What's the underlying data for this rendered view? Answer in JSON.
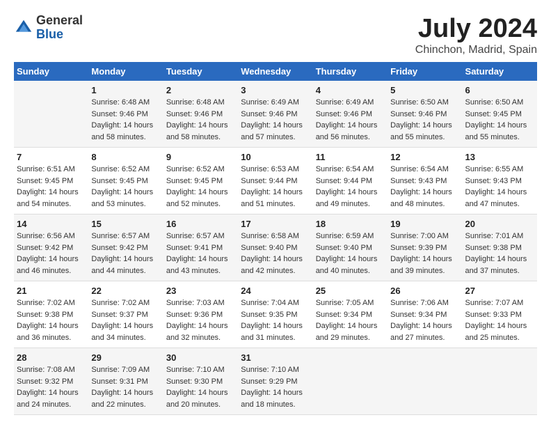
{
  "header": {
    "logo_general": "General",
    "logo_blue": "Blue",
    "main_title": "July 2024",
    "subtitle": "Chinchon, Madrid, Spain"
  },
  "days_of_week": [
    "Sunday",
    "Monday",
    "Tuesday",
    "Wednesday",
    "Thursday",
    "Friday",
    "Saturday"
  ],
  "weeks": [
    [
      {
        "day": "",
        "info": ""
      },
      {
        "day": "1",
        "info": "Sunrise: 6:48 AM\nSunset: 9:46 PM\nDaylight: 14 hours\nand 58 minutes."
      },
      {
        "day": "2",
        "info": "Sunrise: 6:48 AM\nSunset: 9:46 PM\nDaylight: 14 hours\nand 58 minutes."
      },
      {
        "day": "3",
        "info": "Sunrise: 6:49 AM\nSunset: 9:46 PM\nDaylight: 14 hours\nand 57 minutes."
      },
      {
        "day": "4",
        "info": "Sunrise: 6:49 AM\nSunset: 9:46 PM\nDaylight: 14 hours\nand 56 minutes."
      },
      {
        "day": "5",
        "info": "Sunrise: 6:50 AM\nSunset: 9:46 PM\nDaylight: 14 hours\nand 55 minutes."
      },
      {
        "day": "6",
        "info": "Sunrise: 6:50 AM\nSunset: 9:45 PM\nDaylight: 14 hours\nand 55 minutes."
      }
    ],
    [
      {
        "day": "7",
        "info": "Sunrise: 6:51 AM\nSunset: 9:45 PM\nDaylight: 14 hours\nand 54 minutes."
      },
      {
        "day": "8",
        "info": "Sunrise: 6:52 AM\nSunset: 9:45 PM\nDaylight: 14 hours\nand 53 minutes."
      },
      {
        "day": "9",
        "info": "Sunrise: 6:52 AM\nSunset: 9:45 PM\nDaylight: 14 hours\nand 52 minutes."
      },
      {
        "day": "10",
        "info": "Sunrise: 6:53 AM\nSunset: 9:44 PM\nDaylight: 14 hours\nand 51 minutes."
      },
      {
        "day": "11",
        "info": "Sunrise: 6:54 AM\nSunset: 9:44 PM\nDaylight: 14 hours\nand 49 minutes."
      },
      {
        "day": "12",
        "info": "Sunrise: 6:54 AM\nSunset: 9:43 PM\nDaylight: 14 hours\nand 48 minutes."
      },
      {
        "day": "13",
        "info": "Sunrise: 6:55 AM\nSunset: 9:43 PM\nDaylight: 14 hours\nand 47 minutes."
      }
    ],
    [
      {
        "day": "14",
        "info": "Sunrise: 6:56 AM\nSunset: 9:42 PM\nDaylight: 14 hours\nand 46 minutes."
      },
      {
        "day": "15",
        "info": "Sunrise: 6:57 AM\nSunset: 9:42 PM\nDaylight: 14 hours\nand 44 minutes."
      },
      {
        "day": "16",
        "info": "Sunrise: 6:57 AM\nSunset: 9:41 PM\nDaylight: 14 hours\nand 43 minutes."
      },
      {
        "day": "17",
        "info": "Sunrise: 6:58 AM\nSunset: 9:40 PM\nDaylight: 14 hours\nand 42 minutes."
      },
      {
        "day": "18",
        "info": "Sunrise: 6:59 AM\nSunset: 9:40 PM\nDaylight: 14 hours\nand 40 minutes."
      },
      {
        "day": "19",
        "info": "Sunrise: 7:00 AM\nSunset: 9:39 PM\nDaylight: 14 hours\nand 39 minutes."
      },
      {
        "day": "20",
        "info": "Sunrise: 7:01 AM\nSunset: 9:38 PM\nDaylight: 14 hours\nand 37 minutes."
      }
    ],
    [
      {
        "day": "21",
        "info": "Sunrise: 7:02 AM\nSunset: 9:38 PM\nDaylight: 14 hours\nand 36 minutes."
      },
      {
        "day": "22",
        "info": "Sunrise: 7:02 AM\nSunset: 9:37 PM\nDaylight: 14 hours\nand 34 minutes."
      },
      {
        "day": "23",
        "info": "Sunrise: 7:03 AM\nSunset: 9:36 PM\nDaylight: 14 hours\nand 32 minutes."
      },
      {
        "day": "24",
        "info": "Sunrise: 7:04 AM\nSunset: 9:35 PM\nDaylight: 14 hours\nand 31 minutes."
      },
      {
        "day": "25",
        "info": "Sunrise: 7:05 AM\nSunset: 9:34 PM\nDaylight: 14 hours\nand 29 minutes."
      },
      {
        "day": "26",
        "info": "Sunrise: 7:06 AM\nSunset: 9:34 PM\nDaylight: 14 hours\nand 27 minutes."
      },
      {
        "day": "27",
        "info": "Sunrise: 7:07 AM\nSunset: 9:33 PM\nDaylight: 14 hours\nand 25 minutes."
      }
    ],
    [
      {
        "day": "28",
        "info": "Sunrise: 7:08 AM\nSunset: 9:32 PM\nDaylight: 14 hours\nand 24 minutes."
      },
      {
        "day": "29",
        "info": "Sunrise: 7:09 AM\nSunset: 9:31 PM\nDaylight: 14 hours\nand 22 minutes."
      },
      {
        "day": "30",
        "info": "Sunrise: 7:10 AM\nSunset: 9:30 PM\nDaylight: 14 hours\nand 20 minutes."
      },
      {
        "day": "31",
        "info": "Sunrise: 7:10 AM\nSunset: 9:29 PM\nDaylight: 14 hours\nand 18 minutes."
      },
      {
        "day": "",
        "info": ""
      },
      {
        "day": "",
        "info": ""
      },
      {
        "day": "",
        "info": ""
      }
    ]
  ]
}
